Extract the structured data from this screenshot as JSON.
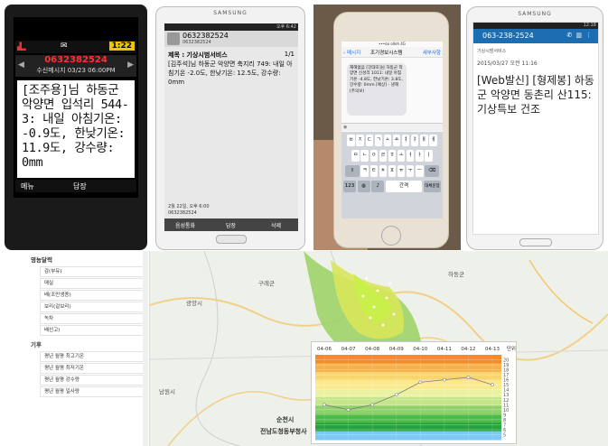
{
  "phone1": {
    "status_time": "1:22",
    "header_number": "0632382524",
    "header_time": "수신메시지 03/23 06:00PM",
    "message": "[조주용]님 하동군 악양면 입석리 544-3: 내일 아침기온: -0.9도, 한낮기온: 11.9도, 강수량: 0mm",
    "softkey_left": "메뉴",
    "softkey_right": "답장"
  },
  "phone2": {
    "brand": "SAMSUNG",
    "status_time": "오후 6:42",
    "contact_number": "0632382524",
    "contact_number2": "0632382524",
    "subject": "제목 : 기상시범서비스",
    "page": "1/1",
    "body": "[김주석]님 하동군 악양면 축지리 749: 내일 아침기온 -2.0도, 한낮기온: 12.5도, 강수량: 0mm",
    "date": "2월 22일, 오후 6:00",
    "date_number": "0632382524",
    "btn_call": "음성통화",
    "btn_reply": "답장",
    "btn_delete": "삭제"
  },
  "phone3": {
    "status": "•••oo olleh 4G",
    "back": "메시지",
    "title": "조기경보시스템",
    "action": "세부사항",
    "bubble": "재해없음 [강대호]님 하동군 악양면 신성리 1011: 내일 아침기온 -4.8도, 한낮기온: 3.8도, 강수량: 0mm [예상] - 냉해(주의보)",
    "keys_row1": [
      "ㅂ",
      "ㅈ",
      "ㄷ",
      "ㄱ",
      "ㅅ",
      "ㅛ",
      "ㅕ",
      "ㅑ",
      "ㅐ",
      "ㅔ"
    ],
    "keys_row2": [
      "ㅁ",
      "ㄴ",
      "ㅇ",
      "ㄹ",
      "ㅎ",
      "ㅗ",
      "ㅓ",
      "ㅏ",
      "ㅣ"
    ],
    "keys_row3": [
      "ㅋ",
      "ㅌ",
      "ㅊ",
      "ㅍ",
      "ㅠ",
      "ㅜ",
      "ㅡ"
    ],
    "key_123": "123",
    "key_space": "간격",
    "key_return": "대체문장"
  },
  "phone4": {
    "brand": "SAMSUNG",
    "status_time": "12:18",
    "number": "063-238-2524",
    "sender": "기상시범서비스",
    "datetime": "2015/03/27 오전 11:16",
    "message": "[Web발신] [형제봉] 하동군 악양면 동촌리 산115: 기상특보 건조"
  },
  "list": {
    "section1": "영농달력",
    "items1": [
      "감(부유)",
      "매실",
      "배(조만생종)",
      "보리(겉보리)",
      "녹차",
      "배선고)"
    ],
    "section2": "기후",
    "items2": [
      "평년 월평 최고기온",
      "평년 월평 최저기온",
      "평년 월평 강수량",
      "평년 월평 일사량"
    ]
  },
  "map": {
    "city1": "순천시",
    "city2": "전남도청동부청사",
    "labels": [
      "광양시",
      "구례군",
      "하동군",
      "남원시"
    ]
  },
  "chart_data": {
    "type": "line",
    "categories": [
      "04-06",
      "04-07",
      "04-08",
      "04-09",
      "04-10",
      "04-11",
      "04-12",
      "04-13"
    ],
    "values": [
      11,
      10,
      11,
      13,
      15.5,
      16,
      16.5,
      15
    ],
    "y_ticks": [
      5,
      6,
      7,
      8,
      9,
      10,
      11,
      12,
      13,
      14,
      15,
      16,
      17,
      18,
      19,
      20
    ],
    "ylim": [
      4,
      21
    ],
    "corner_label": "단위",
    "colors": {
      "line": "#7d7d7d",
      "bands": [
        "#f28c28",
        "#f6b04a",
        "#f9d56e",
        "#fbe98e",
        "#e9f2a0",
        "#c4e58a",
        "#8fd16a",
        "#4cbb48",
        "#27a53c",
        "#7fc7f5"
      ]
    }
  }
}
